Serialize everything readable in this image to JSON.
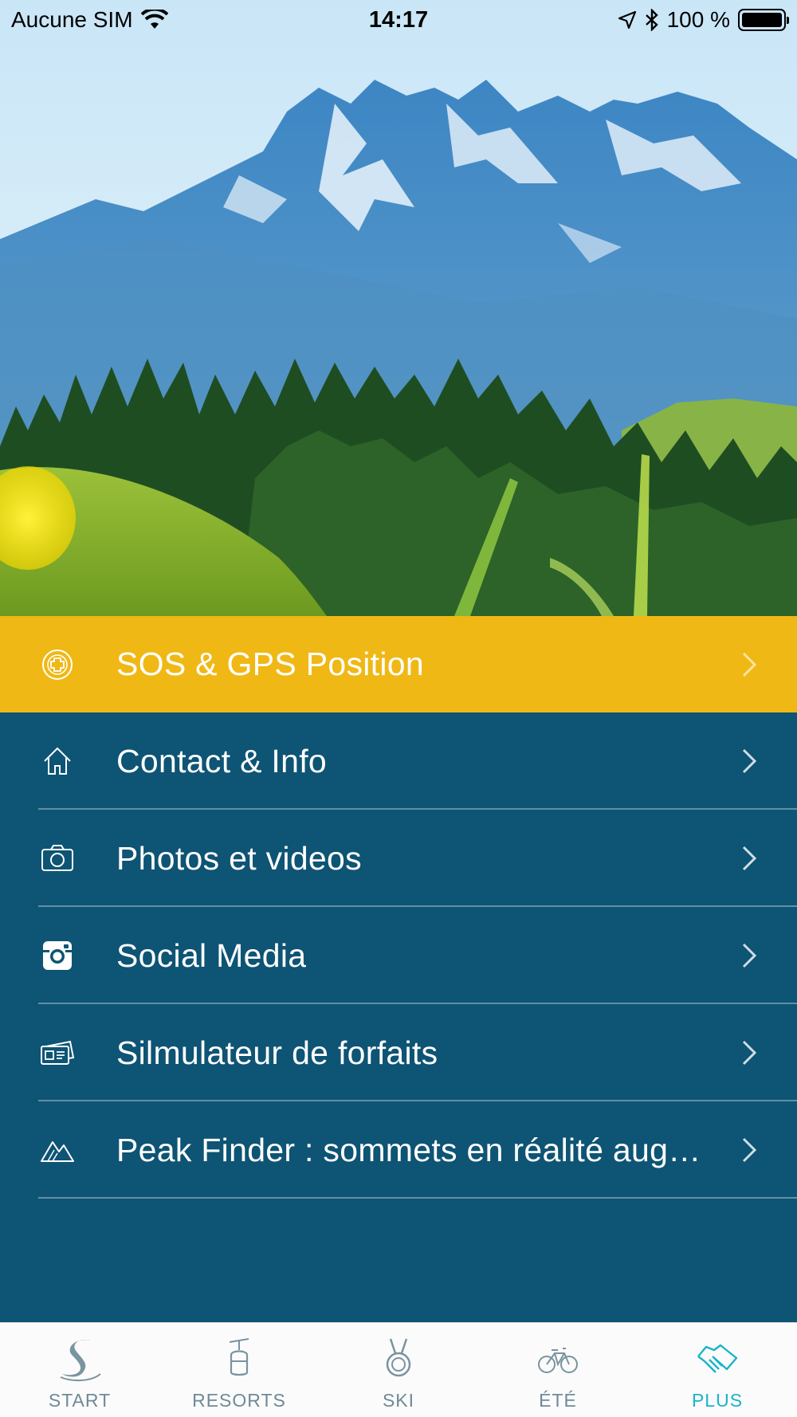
{
  "status_bar": {
    "carrier": "Aucune SIM",
    "time": "14:17",
    "battery": "100 %"
  },
  "menu": {
    "items": [
      {
        "label": "SOS & GPS Position",
        "icon": "sos-cross-icon"
      },
      {
        "label": "Contact & Info",
        "icon": "home-icon"
      },
      {
        "label": "Photos et videos",
        "icon": "camera-icon"
      },
      {
        "label": "Social Media",
        "icon": "instagram-icon"
      },
      {
        "label": "Silmulateur de forfaits",
        "icon": "ski-pass-icon"
      },
      {
        "label": "Peak Finder : sommets en réalité augmentée",
        "icon": "mountain-icon"
      }
    ]
  },
  "tabs": [
    {
      "label": "START",
      "icon": "swan-logo-icon"
    },
    {
      "label": "RESORTS",
      "icon": "gondola-icon"
    },
    {
      "label": "SKI",
      "icon": "medal-icon"
    },
    {
      "label": "ÉTÉ",
      "icon": "bicycle-icon"
    },
    {
      "label": "PLUS",
      "icon": "handshake-icon",
      "active": true
    }
  ],
  "colors": {
    "sos_background": "#f0b815",
    "menu_background": "#0e5474",
    "tab_active": "#1ab3c9",
    "tab_inactive": "#6e8a98"
  }
}
